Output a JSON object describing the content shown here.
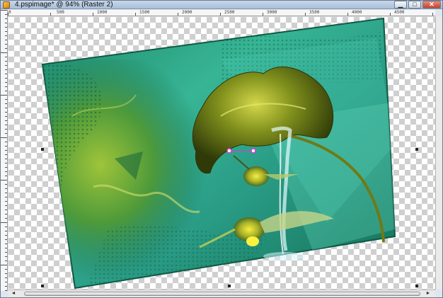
{
  "window": {
    "title": "4.pspimage* @  94% (Raster 2)",
    "minimize_label": "▁",
    "maximize_label": "□",
    "close_label": "✕"
  },
  "rulers": {
    "horizontal_labels": [
      "0",
      "500",
      "1000",
      "1500",
      "2000",
      "2500",
      "3000",
      "3500",
      "4000",
      "4500",
      "5000"
    ],
    "vertical_labels": [
      "0",
      "500",
      "1000",
      "1500",
      "2000",
      "2500",
      "3000",
      "3500"
    ]
  },
  "canvas": {
    "zoom": "94%",
    "layer": "Raster 2",
    "background": "transparent-checkerboard",
    "image_description_icons": [
      "flower-icon",
      "bird-icon",
      "waterfall-icon"
    ]
  },
  "colors": {
    "title_bar": "#b5c8df",
    "close_button": "#c9402a",
    "image_teal": "#2fb89a",
    "image_green": "#3f7f2a",
    "handle_magenta": "#d23ad2"
  },
  "scrollbars": {
    "left_arrow": "◄",
    "right_arrow": "►"
  }
}
